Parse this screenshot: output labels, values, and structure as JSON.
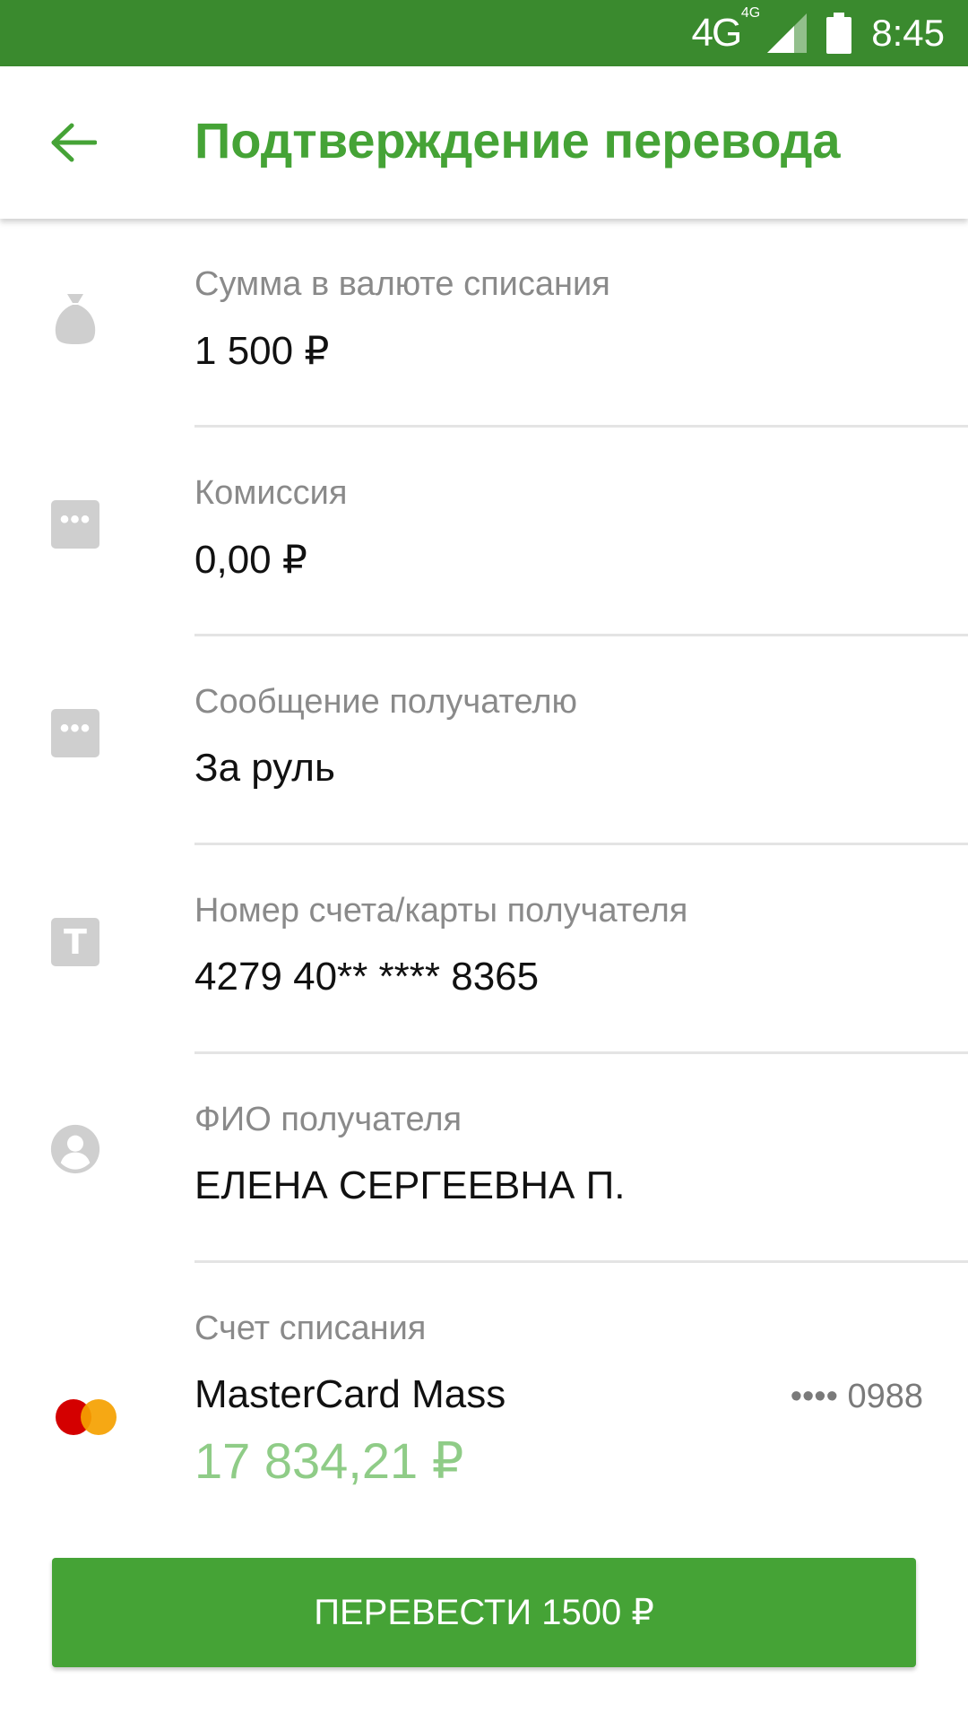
{
  "status_bar": {
    "network": "4G",
    "network_sup": "4G",
    "time": "8:45",
    "signal_icon": "signal-icon",
    "battery_icon": "battery-icon"
  },
  "header": {
    "title": "Подтверждение перевода",
    "back_icon": "arrow-left-icon"
  },
  "rows": [
    {
      "label": "Сумма в валюте списания",
      "value": "1 500 ₽",
      "icon": "money-bag-icon"
    },
    {
      "label": "Комиссия",
      "value": "0,00 ₽",
      "icon": "dots-icon",
      "icon_text": "•••"
    },
    {
      "label": "Сообщение получателю",
      "value": "За руль",
      "icon": "dots-icon",
      "icon_text": "•••"
    },
    {
      "label": "Номер счета/карты получателя",
      "value": "4279 40** **** 8365",
      "icon": "text-icon",
      "icon_text": "T"
    },
    {
      "label": "ФИО получателя",
      "value": "ЕЛЕНА СЕРГЕЕВНА П.",
      "icon": "person-icon"
    }
  ],
  "account": {
    "label": "Счет списания",
    "card_name": "MasterCard Mass",
    "card_number": "•••• 0988",
    "balance": "17 834,21 ₽",
    "icon": "mastercard-logo-icon"
  },
  "action": {
    "label": "ПЕРЕВЕСТИ 1500 ₽"
  },
  "colors": {
    "status_bar": "#3a8a2e",
    "accent": "#45a336",
    "balance": "#8fcc87",
    "icon_gray": "#cfcfcf"
  }
}
